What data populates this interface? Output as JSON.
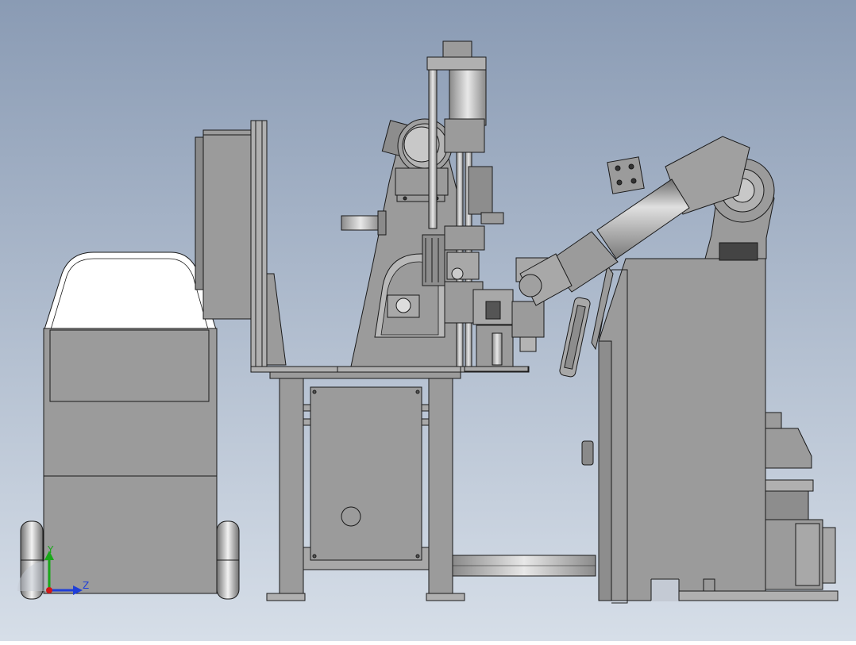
{
  "viewport": {
    "background_top": "#8a9bb4",
    "background_bottom": "#d6dee8",
    "part_fill": "#9b9b9b",
    "part_fill_light": "#b4b4b4",
    "part_fill_dark": "#6e6e6e",
    "edge_color": "#1a1a1a",
    "highlight_fill": "#ffffff"
  },
  "triad": {
    "y_label": "Y",
    "z_label": "Z",
    "y_color": "#1aa81a",
    "z_color": "#1f3fd8",
    "x_color": "#d01818"
  }
}
